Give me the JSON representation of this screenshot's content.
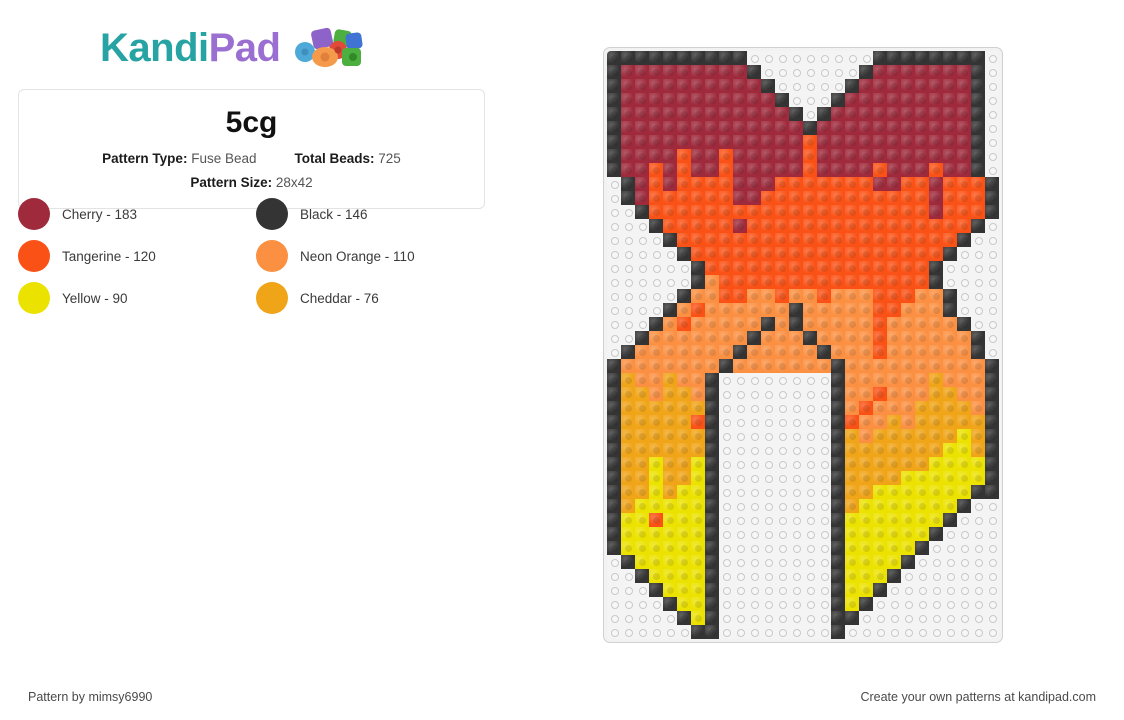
{
  "brand": {
    "name_part1": "Kandi",
    "name_part2": "Pad",
    "logo_icon": "bead-cluster-icon",
    "color_teal": "#27a3a3",
    "color_purple": "#9b6fd1"
  },
  "info": {
    "title": "5cg",
    "pattern_type_label": "Pattern Type:",
    "pattern_type_value": "Fuse Bead",
    "total_beads_label": "Total Beads:",
    "total_beads_value": "725",
    "pattern_size_label": "Pattern Size:",
    "pattern_size_value": "28x42"
  },
  "legend": {
    "items": [
      {
        "name": "Cherry",
        "count": 183,
        "label": "Cherry - 183",
        "color": "#9e2a3c"
      },
      {
        "name": "Black",
        "count": 146,
        "label": "Black - 146",
        "color": "#343434"
      },
      {
        "name": "Tangerine",
        "count": 120,
        "label": "Tangerine - 120",
        "color": "#fa5216"
      },
      {
        "name": "Neon Orange",
        "count": 110,
        "label": "Neon Orange - 110",
        "color": "#fb9042"
      },
      {
        "name": "Yellow",
        "count": 90,
        "label": "Yellow - 90",
        "color": "#ece200"
      },
      {
        "name": "Cheddar",
        "count": 76,
        "label": "Cheddar - 76",
        "color": "#f0a417"
      }
    ]
  },
  "pattern": {
    "cols": 28,
    "rows": 42,
    "palette": {
      "0": "",
      "K": "#343434",
      "C": "#9e2a3c",
      "T": "#fa5216",
      "N": "#fb9042",
      "Y": "#ece200",
      "D": "#f0a417"
    },
    "grid": [
      "KKKKKKKKKK000000000KKKKKKKK0",
      "KCCCCCCCCCK0000000KCCCCCCCK0",
      "KCCCCCCCCCCK00000KCCCCCCCCK0",
      "KCCCCCCCCCCCK000KCCCCCCCCCK0",
      "KCCCCCCCCCCCCK0KCCCCCCCCCCK0",
      "KCCCCCCCCCCCCCKCCCCCCCCCCCK0",
      "KCCCCCCCCCCCCCTCCCCCCCCCCCK0",
      "KCCCCTCCTCCCCCTCCCCCCCCCCCK0",
      "KCCTCTCCTCCCCCTCCCCTCCCTCCK0",
      "0KCTCTTTTCCCTTTTTTTCCTTCTTTK0",
      "0KCTTTTTTCCTTTTTTTTTTTTCTTTK",
      "00KTTTTTTTTTTTTTTTTTTTTCTTTK",
      "000KTTTTTCTTTTTTTTTTTTTTTTK0",
      "0000KTTTTTTTTTTTTTTTTTTTTK00",
      "00000KTTTTTTTTTTTTTTTTTTK000",
      "000000KTTTTTTTTTTTTTTTTK0000",
      "000000KNTTTTTTTTTTTTTTTK0000",
      "00000KNNTTNNTNNTNNNTTTNNK000",
      "0000KNTNNNNNNKNNNNNTTNNNK000",
      "000KNTNNNNNKNKNNNNNTNNNNNK00",
      "00KNNNNNNNKNNNKNNNNTNNNNNNK0",
      "0KNNNNNNNKNNNNNKNNNTNNNNNNK0",
      "KNNNNNNNKNNNNNNNKNNNNNNNNNNK",
      "KDNNDNNK00000000KNNNNNNDNNNK",
      "KDDNDDNK00000000KNNTNNNDDNNK",
      "KDDDDDDK00000000KNTNNNDDDDNK",
      "KDDDDDTK00000000KTNNDNDDDDDK",
      "KDDDDDDK00000000KDNDDDDDDYDK",
      "KDDDDDDK00000000KDDDDDDDYYDK",
      "KDDYDDYK00000000KDDDDDDYYYYK",
      "KDDYDDYK00000000KDDDDYYYYYYK",
      "KDDYDYYK00000000KDDYYYYYYYKK",
      "KDYYYYYK00000000KDYYYYYYYK00",
      "KYYTYYYK00000000KYYYYYYYK000",
      "KYYYYYYK00000000KYYYYYYK0000",
      "KYYYYYYK00000000KYYYYYK00000",
      "0KYYYYYK00000000KYYYYK000000",
      "00KYYYYK00000000KYYYK0000000",
      "000KYYYK00000000KYYK00000000",
      "0000KYYK00000000KYK000000000",
      "00000KYK00000000KK0000000000",
      "000000KK00000000K00000000000"
    ]
  },
  "footer": {
    "credit": "Pattern by mimsy6990",
    "promo": "Create your own patterns at kandipad.com"
  }
}
